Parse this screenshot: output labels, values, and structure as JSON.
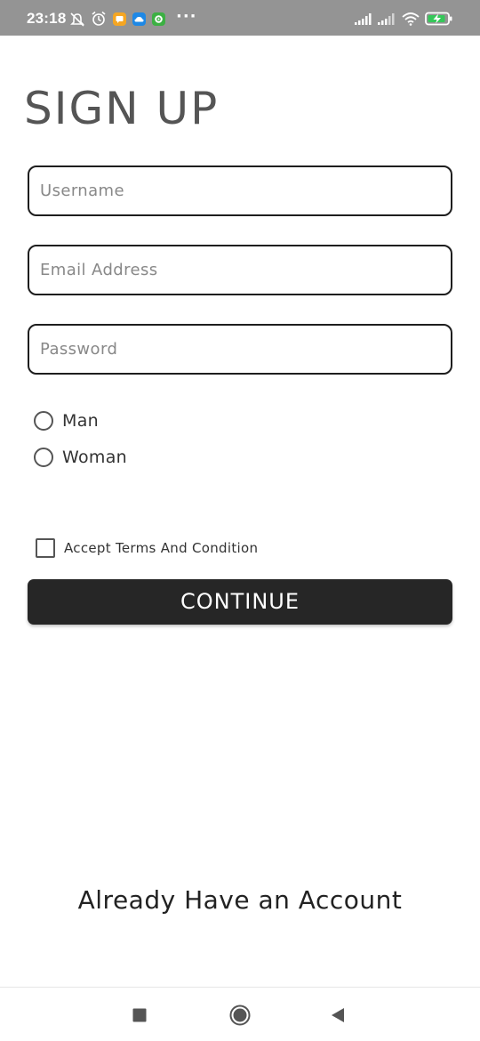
{
  "status_bar": {
    "time": "23:18",
    "more": "···",
    "icons": [
      "mute-notifications-icon",
      "alarm-icon",
      "chat-app-icon",
      "cloud-app-icon",
      "wechat-app-icon",
      "signal-icon",
      "signal-icon-2",
      "wifi-icon",
      "battery-charging-icon"
    ],
    "colors": {
      "background": "#949494",
      "chat_app": "#f5a623",
      "cloud_app": "#1e88e5",
      "green_app": "#3cb043"
    }
  },
  "form": {
    "title": "SIGN UP",
    "username": {
      "placeholder": "Username",
      "value": ""
    },
    "email": {
      "placeholder": "Email Address",
      "value": ""
    },
    "password": {
      "placeholder": "Password",
      "value": ""
    },
    "gender_options": [
      {
        "label": "Man",
        "selected": false
      },
      {
        "label": "Woman",
        "selected": false
      }
    ],
    "terms": {
      "label": "Accept Terms And Condition",
      "checked": false
    },
    "continue_label": "CONTINUE",
    "already_account_label": "Already Have an Account"
  },
  "nav_bar": {
    "icons": [
      "recent-apps-icon",
      "home-icon",
      "back-icon"
    ]
  },
  "colors": {
    "button": "#262626",
    "border": "#1e1e1e",
    "title": "#555555"
  }
}
